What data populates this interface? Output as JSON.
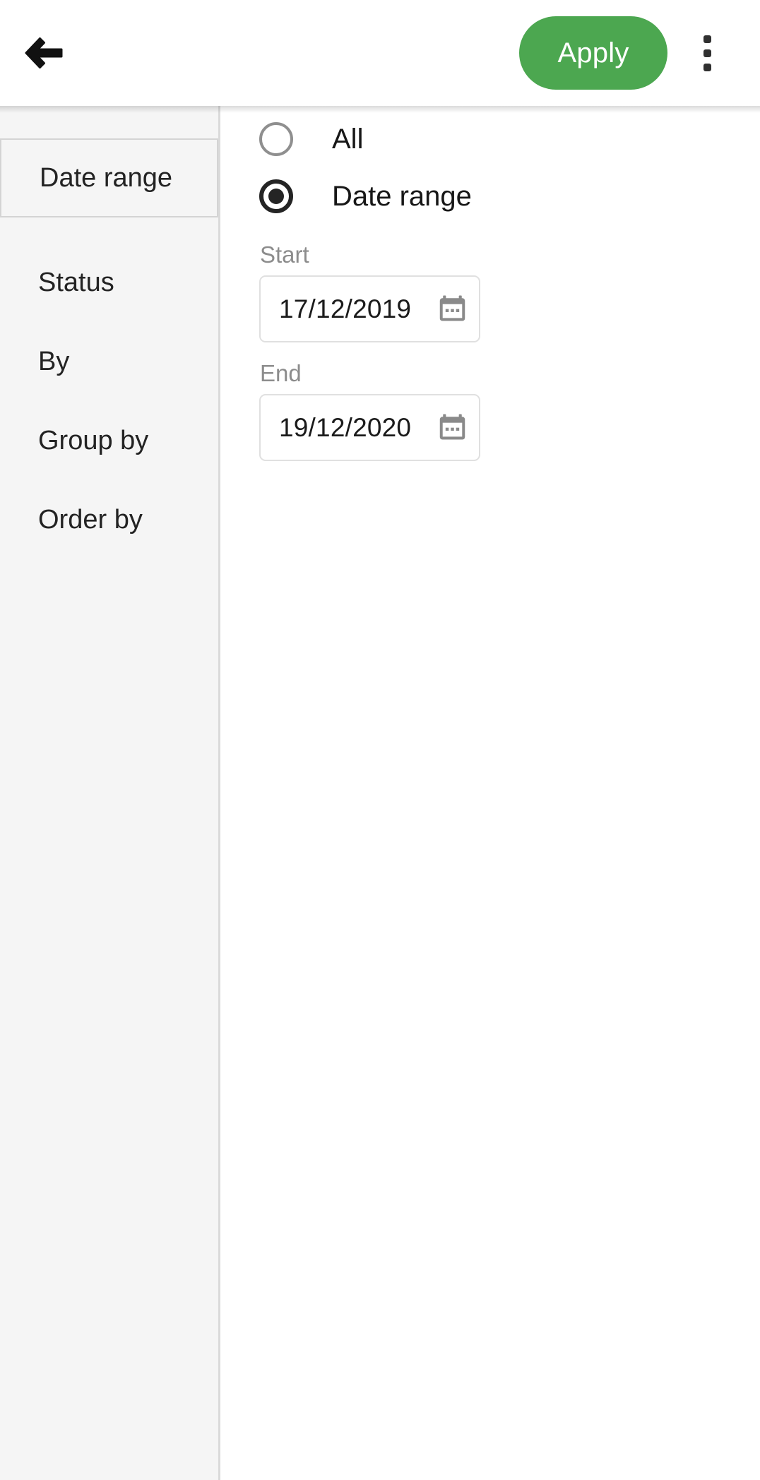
{
  "appbar": {
    "back_icon": "arrow-left-icon",
    "apply_label": "Apply",
    "overflow_icon": "more-vertical-icon",
    "accent_color": "#4CA750"
  },
  "sidebar": {
    "items": [
      {
        "label": "Date range",
        "selected": true
      },
      {
        "label": "Status",
        "selected": false
      },
      {
        "label": "By",
        "selected": false
      },
      {
        "label": "Group by",
        "selected": false
      },
      {
        "label": "Order by",
        "selected": false
      }
    ],
    "background_color": "#f5f5f5"
  },
  "content": {
    "radios": [
      {
        "label": "All",
        "selected": false
      },
      {
        "label": "Date range",
        "selected": true
      }
    ],
    "fields": [
      {
        "label": "Start",
        "value": "17/12/2019",
        "placeholder": "dd/mm/yyyy",
        "icon": "calendar-icon"
      },
      {
        "label": "End",
        "value": "19/12/2020",
        "placeholder": "dd/mm/yyyy",
        "icon": "calendar-icon"
      }
    ]
  }
}
